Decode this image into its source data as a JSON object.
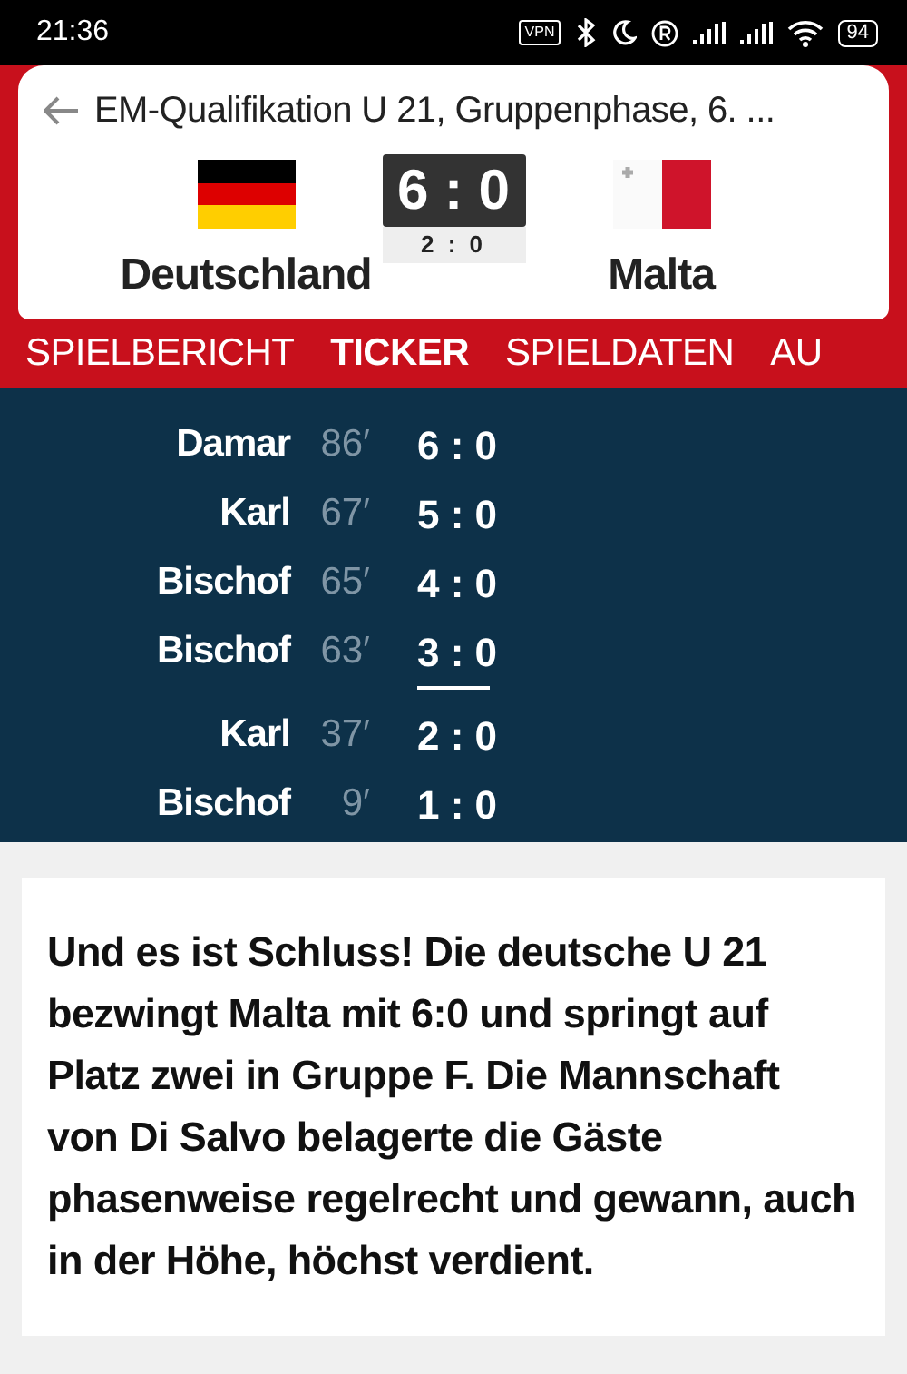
{
  "status_bar": {
    "time": "21:36",
    "vpn": "VPN",
    "battery": "94"
  },
  "header": {
    "title": "EM-Qualifikation U 21, Gruppenphase, 6. ...",
    "home": {
      "name": "Deutschland",
      "kind": "germany"
    },
    "away": {
      "name": "Malta",
      "kind": "malta"
    },
    "score": "6 : 0",
    "halftime": "2 : 0"
  },
  "tabs": [
    {
      "label": "SPIELBERICHT",
      "selected": false
    },
    {
      "label": "TICKER",
      "selected": true
    },
    {
      "label": "SPIELDATEN",
      "selected": false
    },
    {
      "label": "AU",
      "selected": false
    }
  ],
  "goals": [
    {
      "kind": "goal",
      "scorer": "Damar",
      "minute": "86′",
      "score": "6 : 0"
    },
    {
      "kind": "goal",
      "scorer": "Karl",
      "minute": "67′",
      "score": "5 : 0"
    },
    {
      "kind": "goal",
      "scorer": "Bischof",
      "minute": "65′",
      "score": "4 : 0"
    },
    {
      "kind": "goal",
      "scorer": "Bischof",
      "minute": "63′",
      "score": "3 : 0"
    },
    {
      "kind": "halftime"
    },
    {
      "kind": "goal",
      "scorer": "Karl",
      "minute": "37′",
      "score": "2 : 0"
    },
    {
      "kind": "goal",
      "scorer": "Bischof",
      "minute": "9′",
      "score": "1 : 0"
    }
  ],
  "report": {
    "text": "Und es ist Schluss! Die deutsche U 21 bezwingt Malta mit 6:0 und springt auf Platz zwei in Gruppe F. Die Mannschaft von Di Salvo belagerte die Gäste phasenweise regelrecht und gewann, auch in der Höhe, höchst verdient."
  }
}
